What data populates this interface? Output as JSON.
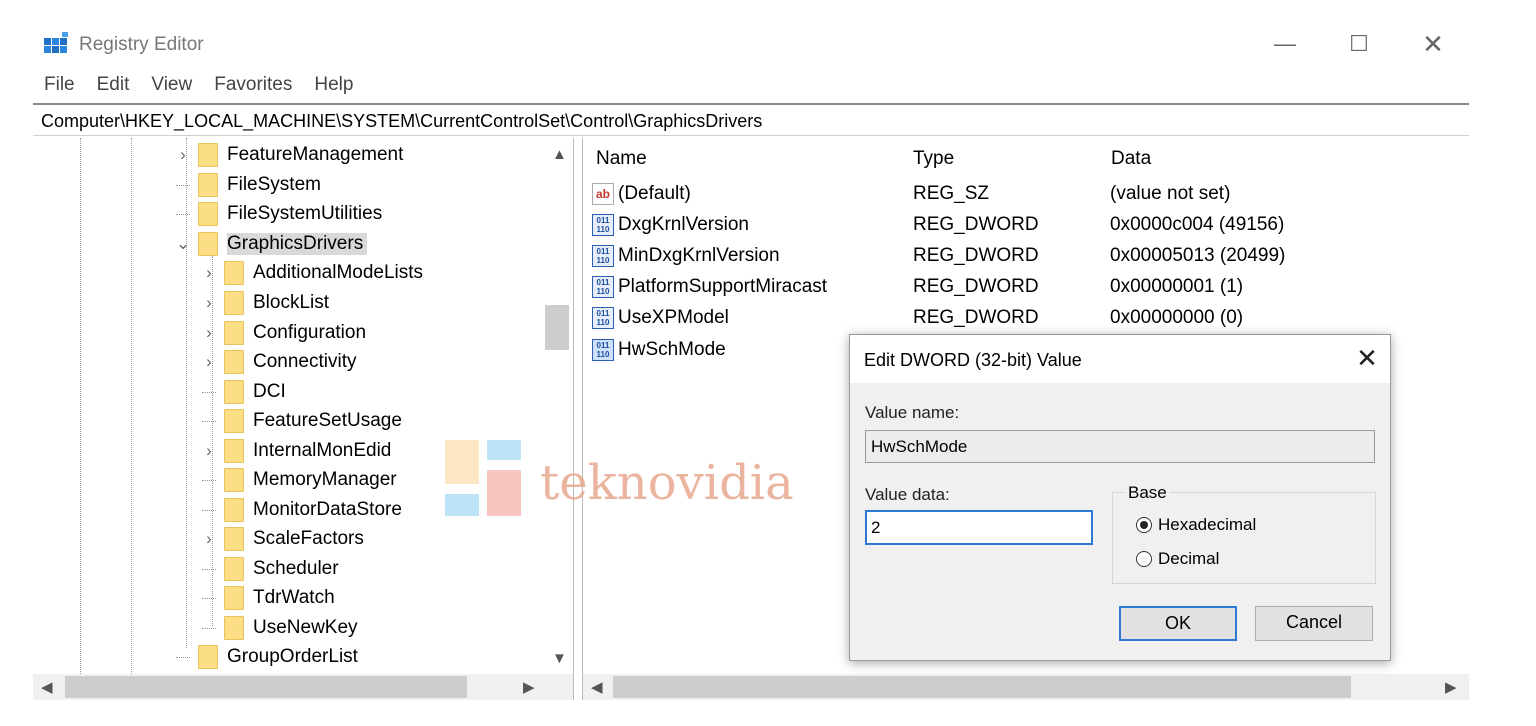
{
  "window": {
    "title": "Registry Editor",
    "minimize_glyph": "—",
    "maximize_glyph": "☐",
    "close_glyph": "✕"
  },
  "menu": [
    "File",
    "Edit",
    "View",
    "Favorites",
    "Help"
  ],
  "address": "Computer\\HKEY_LOCAL_MACHINE\\SYSTEM\\CurrentControlSet\\Control\\GraphicsDrivers",
  "tree": {
    "items": [
      {
        "label": "FeatureManagement",
        "expander": ">"
      },
      {
        "label": "FileSystem",
        "expander": ""
      },
      {
        "label": "FileSystemUtilities",
        "expander": ""
      },
      {
        "label": "GraphicsDrivers",
        "expander": "v",
        "selected": true
      },
      {
        "label": "AdditionalModeLists",
        "expander": ">"
      },
      {
        "label": "BlockList",
        "expander": ">"
      },
      {
        "label": "Configuration",
        "expander": ">"
      },
      {
        "label": "Connectivity",
        "expander": ">"
      },
      {
        "label": "DCI",
        "expander": ""
      },
      {
        "label": "FeatureSetUsage",
        "expander": ""
      },
      {
        "label": "InternalMonEdid",
        "expander": ">"
      },
      {
        "label": "MemoryManager",
        "expander": ""
      },
      {
        "label": "MonitorDataStore",
        "expander": ""
      },
      {
        "label": "ScaleFactors",
        "expander": ">"
      },
      {
        "label": "Scheduler",
        "expander": ""
      },
      {
        "label": "TdrWatch",
        "expander": ""
      },
      {
        "label": "UseNewKey",
        "expander": ""
      },
      {
        "label": "GroupOrderList",
        "expander": ""
      }
    ]
  },
  "list": {
    "columns": [
      "Name",
      "Type",
      "Data"
    ],
    "rows": [
      {
        "icon": "string-value-icon",
        "name": "(Default)",
        "type": "REG_SZ",
        "data": "(value not set)"
      },
      {
        "icon": "binary-value-icon",
        "name": "DxgKrnlVersion",
        "type": "REG_DWORD",
        "data": "0x0000c004 (49156)"
      },
      {
        "icon": "binary-value-icon",
        "name": "MinDxgKrnlVersion",
        "type": "REG_DWORD",
        "data": "0x00005013 (20499)"
      },
      {
        "icon": "binary-value-icon",
        "name": "PlatformSupportMiracast",
        "type": "REG_DWORD",
        "data": "0x00000001 (1)"
      },
      {
        "icon": "binary-value-icon",
        "name": "UseXPModel",
        "type": "REG_DWORD",
        "data": "0x00000000 (0)"
      },
      {
        "icon": "binary-value-icon",
        "name": "HwSchMode",
        "type": "",
        "data": ""
      }
    ]
  },
  "dialog": {
    "title": "Edit DWORD (32-bit) Value",
    "value_name_label": "Value name:",
    "value_name": "HwSchMode",
    "value_data_label": "Value data:",
    "value_data": "2",
    "base_label": "Base",
    "hex_label": "Hexadecimal",
    "dec_label": "Decimal",
    "selected_base": "Hexadecimal",
    "ok_label": "OK",
    "cancel_label": "Cancel"
  },
  "watermark": {
    "text": "teknovidia"
  },
  "colors": {
    "accent": "#2f78d4",
    "folder": "#fcde87",
    "selection": "#d9d9d9"
  }
}
